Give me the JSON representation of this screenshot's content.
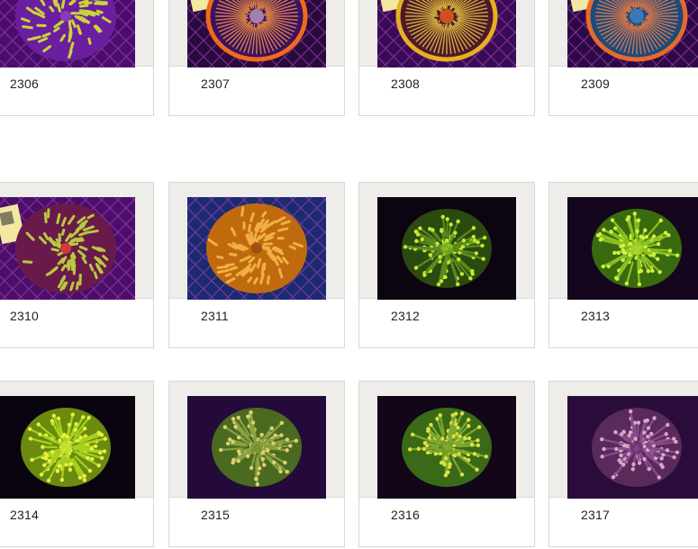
{
  "products": [
    {
      "label": "2306",
      "style": "tentacles",
      "bg": "#4a0d6b",
      "net": true,
      "base": "#6b1fa0",
      "ring": "#7a2fb0",
      "center": "#8b3bb8",
      "tip": "#c8d43a",
      "tag": false
    },
    {
      "label": "2307",
      "style": "ring",
      "bg": "#2a0a3d",
      "net": true,
      "base": "#3a1260",
      "ring": "#f06a1a",
      "center": "#a080b0",
      "tip": "#ff9a3a",
      "tag": true
    },
    {
      "label": "2308",
      "style": "ring",
      "bg": "#3a0b55",
      "net": true,
      "base": "#4e1a2a",
      "ring": "#e8b020",
      "center": "#d05020",
      "tip": "#f0d040",
      "tag": true
    },
    {
      "label": "2309",
      "style": "ring",
      "bg": "#2d0a45",
      "net": true,
      "base": "#1e4a7a",
      "ring": "#e86a2a",
      "center": "#3a78b8",
      "tip": "#ff8040",
      "tag": true
    },
    {
      "label": "2310",
      "style": "tentacles",
      "bg": "#4b0f6a",
      "net": true,
      "base": "#6a1a4a",
      "ring": "#8a2a60",
      "center": "#d03a3a",
      "tip": "#b8c840",
      "tag": true
    },
    {
      "label": "2311",
      "style": "tentacles",
      "bg": "#1c2a70",
      "net": true,
      "base": "#c06a10",
      "ring": "#d88a20",
      "center": "#a05010",
      "tip": "#f0b040",
      "tag": false
    },
    {
      "label": "2312",
      "style": "polyps",
      "bg": "#0c0410",
      "net": false,
      "base": "#2a4a10",
      "ring": "#5a8a20",
      "center": "#7ab020",
      "tip": "#c8e830",
      "tag": false
    },
    {
      "label": "2313",
      "style": "polyps",
      "bg": "#14061c",
      "net": false,
      "base": "#3a6a10",
      "ring": "#8ac020",
      "center": "#a0d030",
      "tip": "#d0f040",
      "tag": false
    },
    {
      "label": "2314",
      "style": "polyps",
      "bg": "#0a0410",
      "net": false,
      "base": "#6a8a10",
      "ring": "#a8d020",
      "center": "#c0e030",
      "tip": "#e8f040",
      "tag": false
    },
    {
      "label": "2315",
      "style": "polyps",
      "bg": "#240a3a",
      "net": false,
      "base": "#4a6a20",
      "ring": "#8aa040",
      "center": "#6a8a30",
      "tip": "#e0d070",
      "tag": false
    },
    {
      "label": "2316",
      "style": "polyps",
      "bg": "#120618",
      "net": false,
      "base": "#3a6a18",
      "ring": "#7aa830",
      "center": "#6a9a28",
      "tip": "#e0e040",
      "tag": false
    },
    {
      "label": "2317",
      "style": "polyps",
      "bg": "#2a0c3a",
      "net": false,
      "base": "#5a2a5a",
      "ring": "#8a4a8a",
      "center": "#6a3070",
      "tip": "#d8a8c8",
      "tag": false
    }
  ]
}
